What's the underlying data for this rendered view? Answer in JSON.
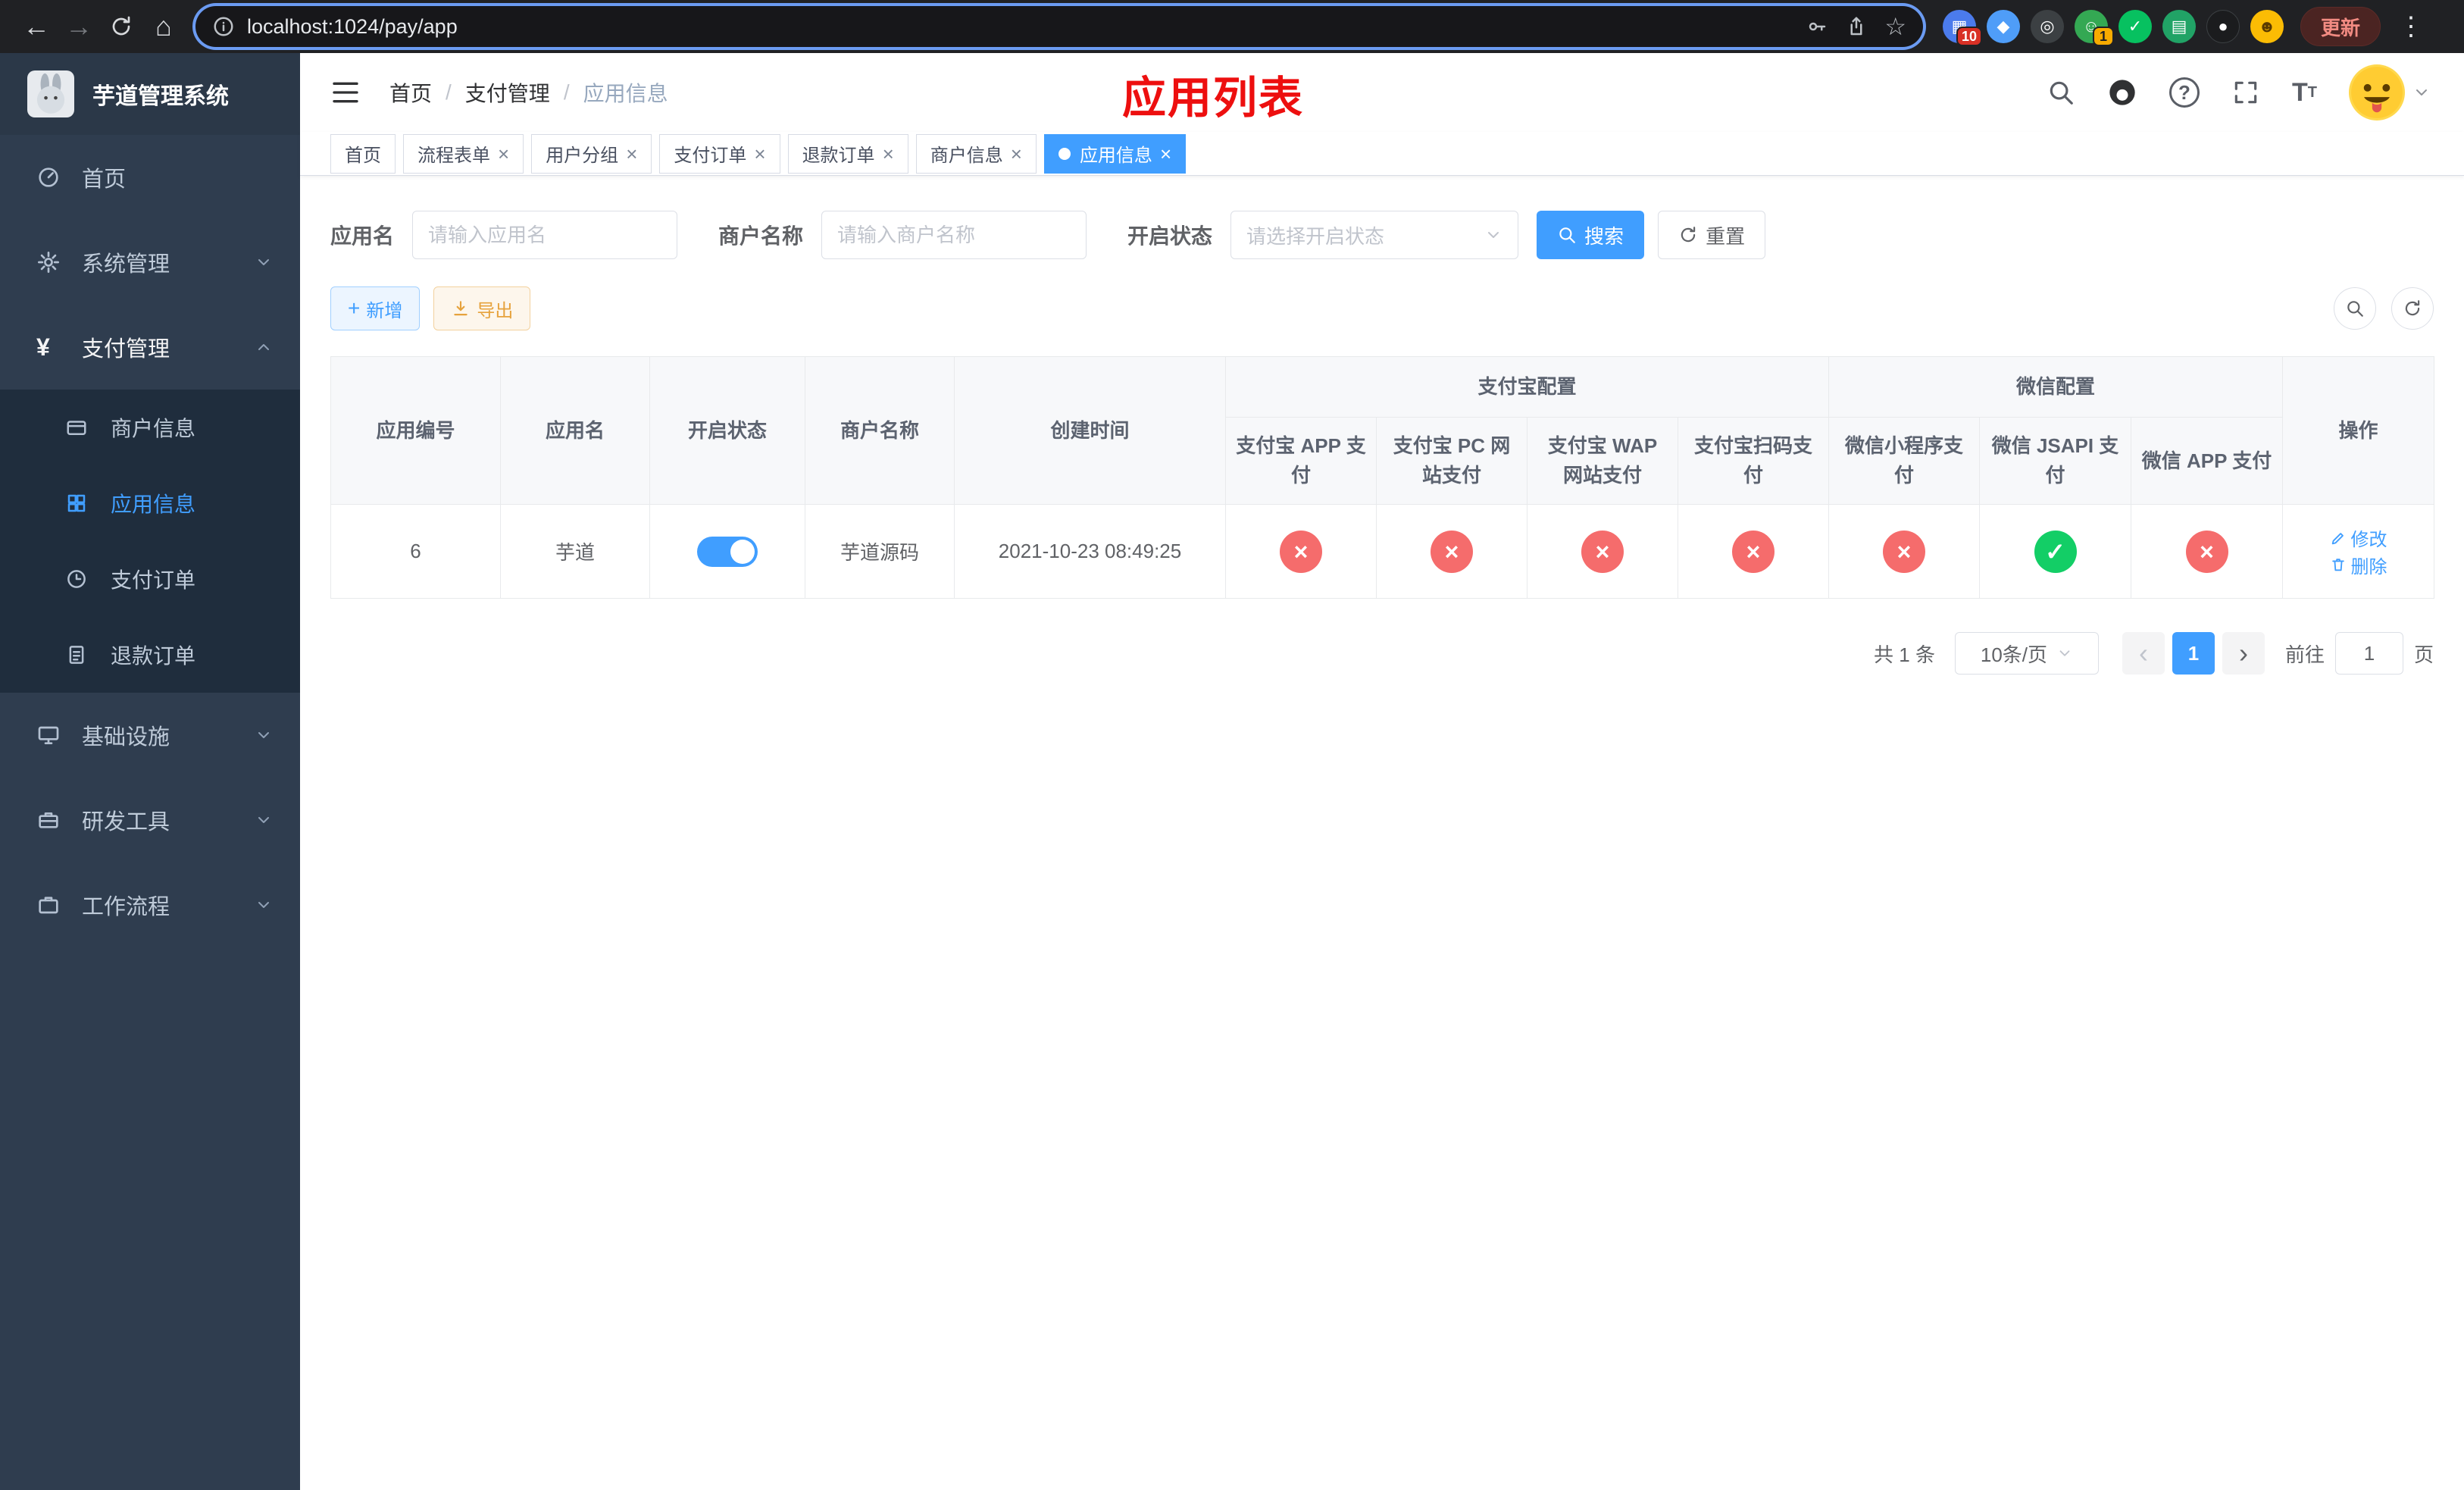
{
  "browser": {
    "url": "localhost:1024/pay/app",
    "update_label": "更新",
    "ext_badge_puzzle": "10",
    "ext_badge_avatar": "1"
  },
  "sidebar": {
    "title": "芋道管理系统",
    "items": [
      {
        "label": "首页"
      },
      {
        "label": "系统管理"
      },
      {
        "label": "支付管理"
      },
      {
        "label": "基础设施"
      },
      {
        "label": "研发工具"
      },
      {
        "label": "工作流程"
      }
    ],
    "payment_children": [
      {
        "label": "商户信息"
      },
      {
        "label": "应用信息"
      },
      {
        "label": "支付订单"
      },
      {
        "label": "退款订单"
      }
    ]
  },
  "header": {
    "breadcrumb": [
      "首页",
      "支付管理",
      "应用信息"
    ],
    "page_title": "应用列表"
  },
  "tabs": [
    {
      "label": "首页"
    },
    {
      "label": "流程表单"
    },
    {
      "label": "用户分组"
    },
    {
      "label": "支付订单"
    },
    {
      "label": "退款订单"
    },
    {
      "label": "商户信息"
    },
    {
      "label": "应用信息"
    }
  ],
  "filters": {
    "app_name_label": "应用名",
    "app_name_placeholder": "请输入应用名",
    "merchant_label": "商户名称",
    "merchant_placeholder": "请输入商户名称",
    "status_label": "开启状态",
    "status_placeholder": "请选择开启状态",
    "search_label": "搜索",
    "reset_label": "重置"
  },
  "toolbar": {
    "add_label": "新增",
    "export_label": "导出"
  },
  "table": {
    "columns": {
      "app_id": "应用编号",
      "app_name": "应用名",
      "status": "开启状态",
      "merchant": "商户名称",
      "created": "创建时间",
      "alipay_group": "支付宝配置",
      "wechat_group": "微信配置",
      "alipay_app": "支付宝 APP 支付",
      "alipay_pc": "支付宝 PC 网站支付",
      "alipay_wap": "支付宝 WAP 网站支付",
      "alipay_qr": "支付宝扫码支付",
      "wx_mini": "微信小程序支付",
      "wx_jsapi": "微信 JSAPI 支付",
      "wx_app": "微信 APP 支付",
      "actions": "操作"
    },
    "rows": [
      {
        "app_id": "6",
        "app_name": "芋道",
        "status_on": true,
        "merchant": "芋道源码",
        "created": "2021-10-23 08:49:25",
        "alipay_app": "disabled",
        "alipay_pc": "disabled",
        "alipay_wap": "disabled",
        "alipay_qr": "disabled",
        "wx_mini": "disabled",
        "wx_jsapi": "enabled",
        "wx_app": "disabled",
        "edit_label": "修改",
        "delete_label": "删除"
      }
    ]
  },
  "pagination": {
    "total": "共 1 条",
    "page_size": "10条/页",
    "current_page": "1",
    "goto_prefix": "前往",
    "goto_value": "1",
    "goto_suffix": "页"
  },
  "colors": {
    "primary": "#409eff",
    "success": "#13ce66",
    "danger": "#f56c6c",
    "warning": "#e6a23c",
    "title_red": "#ed0f0f",
    "sidebar_bg": "#2f3d4f",
    "submenu_bg": "#1f2d3d"
  }
}
